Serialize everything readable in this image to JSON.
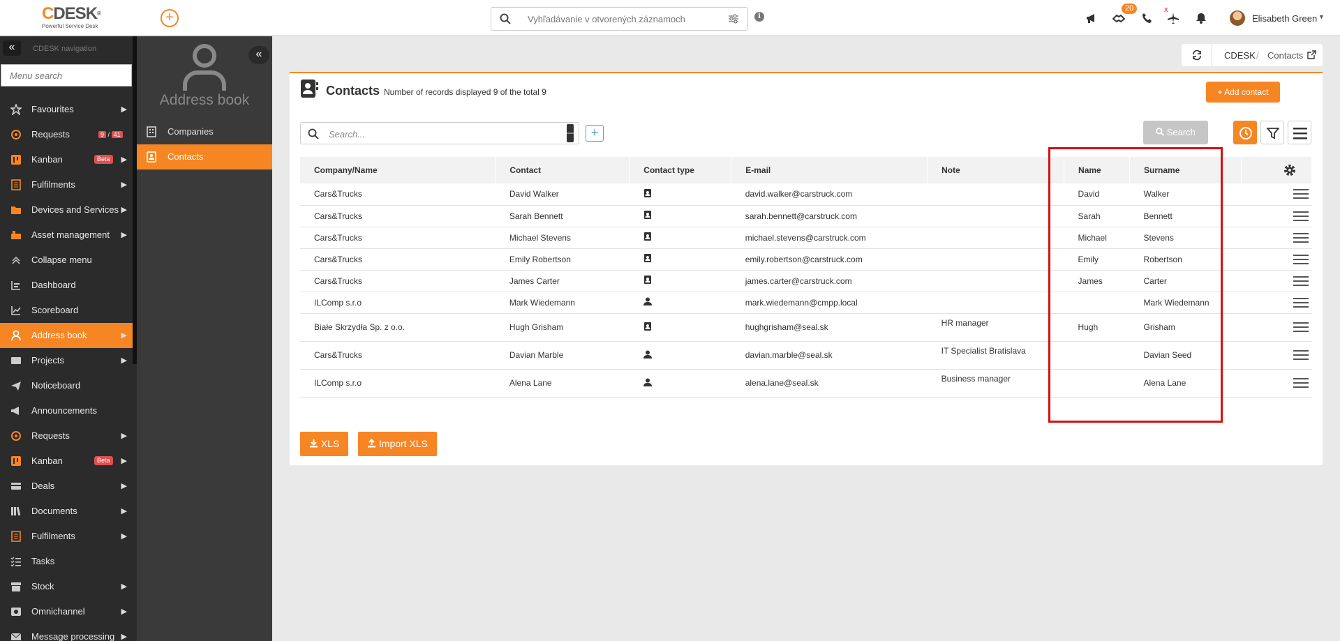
{
  "topbar": {
    "logo_brand": "DESK",
    "logo_c": "C",
    "logo_tagline": "Powerful Service Desk",
    "search_placeholder": "Vyhľadávanie v otvorených záznamoch",
    "notification_count": "20",
    "user_name": "Elisabeth Green"
  },
  "leftnav": {
    "header": "CDESK navigation",
    "menu_search_placeholder": "Menu search",
    "items": [
      {
        "label": "Favourites",
        "icon": "star-icon",
        "arrow": true
      },
      {
        "label": "Requests",
        "icon": "requests-icon",
        "count_a": "9",
        "count_sep": "/",
        "count_b": "41"
      },
      {
        "label": "Kanban",
        "icon": "kanban-icon",
        "beta": "Beta",
        "arrow": true
      },
      {
        "label": "Fulfilments",
        "icon": "fulfilments-icon",
        "arrow": true
      },
      {
        "label": "Devices and Services",
        "icon": "folder-icon",
        "arrow": true
      },
      {
        "label": "Asset management",
        "icon": "asset-icon",
        "arrow": true
      },
      {
        "label": "Collapse menu",
        "icon": "chevron-up-icon"
      },
      {
        "label": "Dashboard",
        "icon": "dashboard-icon"
      },
      {
        "label": "Scoreboard",
        "icon": "chart-icon"
      },
      {
        "label": "Address book",
        "icon": "person-icon",
        "arrow": true,
        "active": true
      },
      {
        "label": "Projects",
        "icon": "projects-icon",
        "arrow": true
      },
      {
        "label": "Noticeboard",
        "icon": "paper-plane-icon"
      },
      {
        "label": "Announcements",
        "icon": "megaphone-icon"
      },
      {
        "label": "Requests",
        "icon": "requests-icon",
        "arrow": true
      },
      {
        "label": "Kanban",
        "icon": "kanban-icon",
        "beta": "Beta",
        "arrow": true
      },
      {
        "label": "Deals",
        "icon": "deals-icon",
        "arrow": true
      },
      {
        "label": "Documents",
        "icon": "documents-icon",
        "arrow": true
      },
      {
        "label": "Fulfilments",
        "icon": "fulfilments-icon",
        "arrow": true
      },
      {
        "label": "Tasks",
        "icon": "tasks-icon"
      },
      {
        "label": "Stock",
        "icon": "stock-icon",
        "arrow": true
      },
      {
        "label": "Omnichannel",
        "icon": "omnichannel-icon",
        "arrow": true
      },
      {
        "label": "Message processing",
        "icon": "message-icon",
        "arrow": true
      }
    ]
  },
  "subnav": {
    "title": "Address book",
    "items": [
      {
        "label": "Companies",
        "icon": "building-icon"
      },
      {
        "label": "Contacts",
        "icon": "contact-card-icon",
        "active": true
      }
    ]
  },
  "breadcrumb": {
    "root": "CDESK",
    "separator": "/",
    "current": "Contacts"
  },
  "panel": {
    "title": "Contacts",
    "subtitle": "Number of records displayed 9 of the total 9",
    "add_button": "+ Add contact",
    "search_placeholder": "Search...",
    "search_button": "Search",
    "xls_button": "XLS",
    "import_button": "Import XLS"
  },
  "table": {
    "columns": [
      "Company/Name",
      "Contact",
      "Contact type",
      "E-mail",
      "Note",
      "Name",
      "Surname"
    ],
    "rows": [
      {
        "company": "Cars&Trucks",
        "contact": "David Walker",
        "type": "card",
        "email": "david.walker@carstruck.com",
        "note": "",
        "name": "David",
        "surname": "Walker"
      },
      {
        "company": "Cars&Trucks",
        "contact": "Sarah Bennett",
        "type": "card",
        "email": "sarah.bennett@carstruck.com",
        "note": "",
        "name": "Sarah",
        "surname": "Bennett"
      },
      {
        "company": "Cars&Trucks",
        "contact": "Michael Stevens",
        "type": "card",
        "email": "michael.stevens@carstruck.com",
        "note": "",
        "name": "Michael",
        "surname": "Stevens"
      },
      {
        "company": "Cars&Trucks",
        "contact": "Emily Robertson",
        "type": "card",
        "email": "emily.robertson@carstruck.com",
        "note": "",
        "name": "Emily",
        "surname": "Robertson"
      },
      {
        "company": "Cars&Trucks",
        "contact": "James Carter",
        "type": "card",
        "email": "james.carter@carstruck.com",
        "note": "",
        "name": "James",
        "surname": "Carter"
      },
      {
        "company": "ILComp s.r.o",
        "contact": "Mark Wiedemann",
        "type": "person",
        "email": "mark.wiedemann@cmpp.local",
        "note": "",
        "name": "",
        "surname": "Mark Wiedemann"
      },
      {
        "company": "Białe Skrzydła Sp. z o.o.",
        "contact": "Hugh Grisham",
        "type": "card",
        "email": "hughgrisham@seal.sk",
        "note": "HR manager",
        "name": "Hugh",
        "surname": "Grisham"
      },
      {
        "company": "Cars&Trucks",
        "contact": "Davian Marble",
        "type": "person",
        "email": "davian.marble@seal.sk",
        "note": "IT Specialist Bratislava",
        "name": "",
        "surname": "Davian Seed"
      },
      {
        "company": "ILComp s.r.o",
        "contact": "Alena Lane",
        "type": "person",
        "email": "alena.lane@seal.sk",
        "note": "Business manager",
        "name": "",
        "surname": "Alena Lane"
      }
    ]
  },
  "colors": {
    "accent": "#f68624",
    "highlight": "#d90f0f",
    "nav_bg": "#2b2b2b"
  }
}
